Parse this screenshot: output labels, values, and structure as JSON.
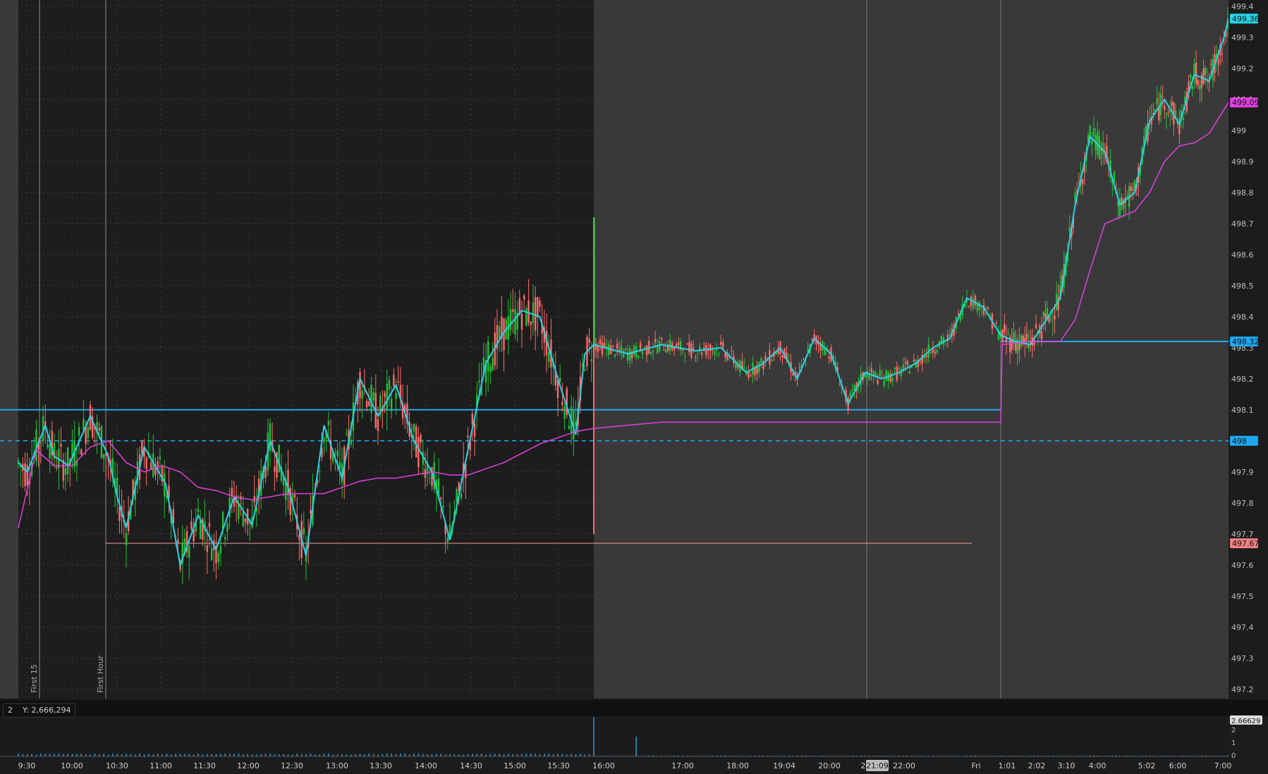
{
  "chart_data": {
    "type": "candlestick",
    "y_axis": {
      "ticks": [
        "497.2",
        "497.3",
        "497.4",
        "497.5",
        "497.6",
        "497.7",
        "497.8",
        "497.9",
        "498",
        "498.1",
        "498.2",
        "498.3",
        "498.4",
        "498.5",
        "498.6",
        "498.7",
        "498.8",
        "498.9",
        "499",
        "499.1",
        "499.2",
        "499.3",
        "499.4"
      ],
      "ylim": [
        497.17,
        499.42
      ]
    },
    "x_axis": {
      "labels": [
        "9:30",
        "10:00",
        "10:30",
        "11:00",
        "11:30",
        "12:00",
        "12:30",
        "13:00",
        "13:30",
        "14:00",
        "14:30",
        "15:00",
        "15:30",
        "16:00",
        "17:00",
        "18:00",
        "19:04",
        "20:00",
        "2",
        "22:00",
        "Fri",
        "1:01",
        "2:02",
        "3:10",
        "4:00",
        "5:02",
        "6:00",
        "7:00"
      ],
      "cursor_label": "21:09"
    },
    "markers": [
      "First 15",
      "First Hour"
    ],
    "price_badges": [
      {
        "label": "499.36",
        "value": 499.36,
        "color": "#29d3e8"
      },
      {
        "label": "499.09",
        "value": 499.09,
        "color": "#e040e0"
      },
      {
        "label": "498.32",
        "value": 498.32,
        "color": "#1ea8f0"
      },
      {
        "label": "498",
        "value": 498.0,
        "color": "#1ea8f0"
      },
      {
        "label": "497.67",
        "value": 497.67,
        "color": "#f08080"
      }
    ],
    "levels": [
      {
        "value": 498.1,
        "style": "solid",
        "color": "#1ea8f0"
      },
      {
        "value": 498.0,
        "style": "dashed",
        "color": "#1ea8f0"
      },
      {
        "value": 497.67,
        "style": "thin",
        "color": "#f4a0a0"
      },
      {
        "value": 498.32,
        "style": "solid",
        "color": "#1ea8f0"
      }
    ],
    "series": [
      {
        "kind": "ema",
        "color": "#29d3e8",
        "points": [
          [
            0,
            497.93
          ],
          [
            0.5,
            497.9
          ],
          [
            1.5,
            498.05
          ],
          [
            2,
            497.95
          ],
          [
            2.8,
            497.92
          ],
          [
            4,
            498.08
          ],
          [
            5,
            497.95
          ],
          [
            5.5,
            497.82
          ],
          [
            6,
            497.72
          ],
          [
            7,
            497.98
          ],
          [
            8.2,
            497.86
          ],
          [
            9,
            497.6
          ],
          [
            10,
            497.76
          ],
          [
            11,
            497.65
          ],
          [
            12,
            497.82
          ],
          [
            13,
            497.73
          ],
          [
            14,
            498
          ],
          [
            15,
            497.85
          ],
          [
            16,
            497.63
          ],
          [
            17,
            498.05
          ],
          [
            18,
            497.88
          ],
          [
            19,
            498.2
          ],
          [
            20,
            498.08
          ],
          [
            21,
            498.18
          ],
          [
            22,
            498
          ],
          [
            23,
            497.9
          ],
          [
            24,
            497.68
          ],
          [
            25,
            497.97
          ],
          [
            26,
            498.25
          ],
          [
            27,
            498.35
          ],
          [
            28,
            498.42
          ],
          [
            29,
            498.4
          ],
          [
            30,
            498.2
          ],
          [
            31,
            498.02
          ],
          [
            31.5,
            498.28
          ],
          [
            32,
            498.31
          ],
          [
            34,
            498.28
          ],
          [
            36,
            498.31
          ],
          [
            38,
            498.29
          ],
          [
            39.5,
            498.3
          ],
          [
            41,
            498.22
          ],
          [
            42,
            498.25
          ],
          [
            43,
            498.3
          ],
          [
            44,
            498.2
          ],
          [
            45,
            498.33
          ],
          [
            46,
            498.28
          ],
          [
            47,
            498.12
          ],
          [
            48,
            498.22
          ],
          [
            49,
            498.2
          ],
          [
            50,
            498.22
          ],
          [
            51,
            498.25
          ],
          [
            52,
            498.3
          ],
          [
            53,
            498.33
          ],
          [
            54,
            498.46
          ],
          [
            55,
            498.43
          ],
          [
            56,
            498.34
          ],
          [
            57,
            498.32
          ],
          [
            58,
            498.31
          ],
          [
            60,
            498.46
          ],
          [
            61,
            498.76
          ],
          [
            62,
            498.98
          ],
          [
            63,
            498.93
          ],
          [
            64,
            498.76
          ],
          [
            65,
            498.8
          ],
          [
            66,
            499.03
          ],
          [
            67,
            499.1
          ],
          [
            68,
            499.02
          ],
          [
            69,
            499.18
          ],
          [
            70,
            499.16
          ],
          [
            71,
            499.3
          ],
          [
            71.3,
            499.36
          ]
        ]
      },
      {
        "kind": "vwap",
        "color": "#e040e0",
        "points": [
          [
            0,
            497.72
          ],
          [
            1,
            497.97
          ],
          [
            2,
            497.92
          ],
          [
            3,
            497.92
          ],
          [
            4,
            497.98
          ],
          [
            5,
            498
          ],
          [
            6,
            497.93
          ],
          [
            7,
            497.9
          ],
          [
            8,
            497.92
          ],
          [
            9,
            497.9
          ],
          [
            10,
            497.85
          ],
          [
            11,
            497.84
          ],
          [
            12,
            497.82
          ],
          [
            13,
            497.81
          ],
          [
            14,
            497.82
          ],
          [
            15,
            497.83
          ],
          [
            16,
            497.83
          ],
          [
            17,
            497.83
          ],
          [
            18,
            497.85
          ],
          [
            19,
            497.87
          ],
          [
            20,
            497.88
          ],
          [
            21,
            497.88
          ],
          [
            22,
            497.89
          ],
          [
            23,
            497.9
          ],
          [
            24,
            497.89
          ],
          [
            25,
            497.89
          ],
          [
            26,
            497.91
          ],
          [
            27,
            497.93
          ],
          [
            28,
            497.96
          ],
          [
            29,
            497.99
          ],
          [
            30,
            498.01
          ],
          [
            31,
            498.03
          ],
          [
            32,
            498.04
          ],
          [
            34,
            498.05
          ],
          [
            36,
            498.06
          ],
          [
            48,
            498.06
          ],
          [
            56,
            498.06
          ],
          [
            56.1,
            498.31
          ],
          [
            58,
            498.32
          ],
          [
            60,
            498.32
          ],
          [
            61,
            498.39
          ],
          [
            62,
            498.55
          ],
          [
            63,
            498.7
          ],
          [
            64,
            498.72
          ],
          [
            65,
            498.74
          ],
          [
            66,
            498.8
          ],
          [
            67,
            498.9
          ],
          [
            68,
            498.95
          ],
          [
            69,
            498.96
          ],
          [
            70,
            498.99
          ],
          [
            71.3,
            499.09
          ]
        ]
      }
    ],
    "volume": {
      "scale_label": "2.66629",
      "ticks": [
        "2",
        "1",
        "0"
      ],
      "spike_label": "Y: 2,666,294",
      "pane_index": "2"
    }
  }
}
